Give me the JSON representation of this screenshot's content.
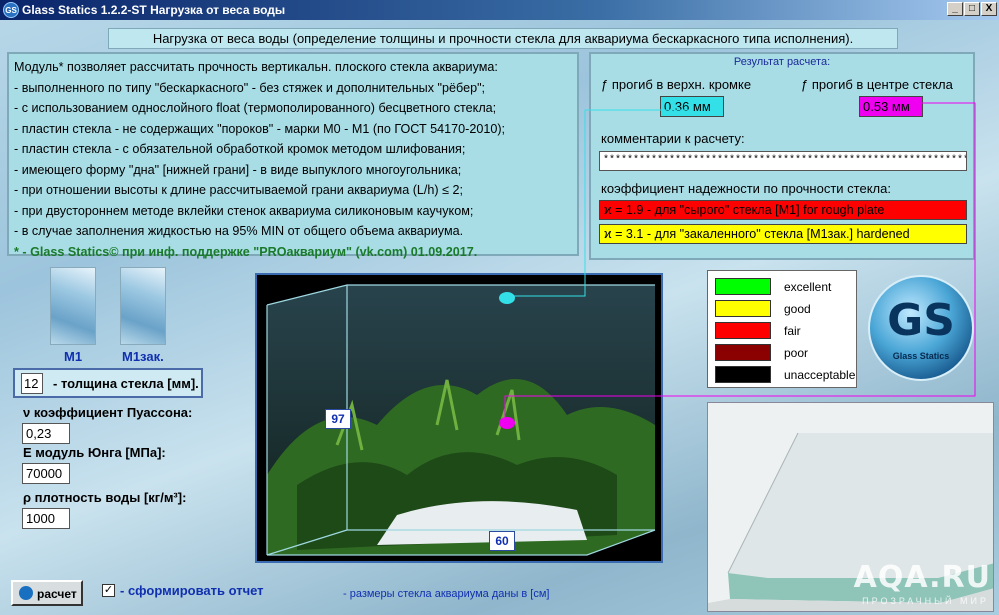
{
  "window": {
    "title": "Glass Statics 1.2.2-ST Нагрузка от веса воды",
    "controls": {
      "minimize": "_",
      "restore": "□",
      "close": "X"
    },
    "icon_text": "GS"
  },
  "header": "Нагрузка от веса воды (определение толщины и прочности стекла для аквариума бескаркасного типа исполнения).",
  "description": {
    "lines": [
      "Модуль* позволяет рассчитать прочность вертикальн. плоского стекла аквариума:",
      "- выполненного  по типу \"бескаркасного\"  - без стяжек и дополнительных \"рёбер\";",
      "- с использованием однослойного float (термополированного) бесцветного стекла;",
      "- пластин стекла  - не содержащих \"пороков\" - марки М0 - М1 (по ГОСТ 54170-2010);",
      "- пластин стекла  - с  обязательной  обработкой  кромок  методом шлифования;",
      "- имеющего форму  \"дна\" [нижней грани] - в  виде  выпуклого многоугольника;",
      "- при отношении  высоты  к  длине  рассчитываемой грани аквариума (L/h) ≤ 2;",
      "- при двустороннем методе вклейки стенок аквариума силиконовым каучуком;",
      "- в случае  заполнения  жидкостью  на  95% MIN  от  общего объема аквариума."
    ],
    "credit": "* - Glass Statics© при инф. поддержке \"PROаквариум\" (vk.com) 01.09.2017."
  },
  "results": {
    "title": "Результат расчета:",
    "top_deflection_label": "ƒ прогиб в верхн. кромке",
    "top_deflection_value": "0.36 мм",
    "center_deflection_label": "ƒ прогиб в  центре стекла",
    "center_deflection_value": "0.53 мм",
    "comments_label": "комментарии к расчету:",
    "comments_value": "**************************************************************************",
    "safety_label": "коэффициент надежности по прочности стекла:",
    "k_rough": "ϰ = 1.9 - для \"сырого\" стекла [М1] for rough plate",
    "k_hardened": "ϰ = 3.1 - для \"закаленного\" стекла [М1зак.] hardened",
    "colors": {
      "top": "#33e0e8",
      "center": "#f000f0",
      "rough": "#ff0000",
      "hardened": "#ffff00"
    }
  },
  "glass_types": [
    {
      "label": "M1"
    },
    {
      "label": "M1зак."
    }
  ],
  "thickness": {
    "value": "12",
    "label": "- толщина стекла [мм]."
  },
  "params": {
    "poisson_label": "ν коэффициент   Пуассона:",
    "poisson_value": "0,23",
    "young_label": "E    модуль  Юнга   [МПа]:",
    "young_value": "70000",
    "density_label": "ρ плотность воды   [кг/м³]:",
    "density_value": "1000"
  },
  "aquarium": {
    "height": "97",
    "length": "60"
  },
  "legend": [
    {
      "label": "excellent",
      "color": "#00ff00"
    },
    {
      "label": "good",
      "color": "#ffff00"
    },
    {
      "label": "fair",
      "color": "#ff0000"
    },
    {
      "label": "poor",
      "color": "#8b0000"
    },
    {
      "label": "unacceptable",
      "color": "#000000"
    }
  ],
  "logo": {
    "letters": "GS",
    "text": "Glass Statics"
  },
  "footer": {
    "calc_button": "расчет",
    "report_label": "- сформировать отчет",
    "report_checked": "✓",
    "units_note": "- размеры стекла аквариума даны в [см]"
  },
  "watermark": {
    "main": "AQA.RU",
    "sub": "ПРОЗРАЧНЫЙ МИР"
  }
}
